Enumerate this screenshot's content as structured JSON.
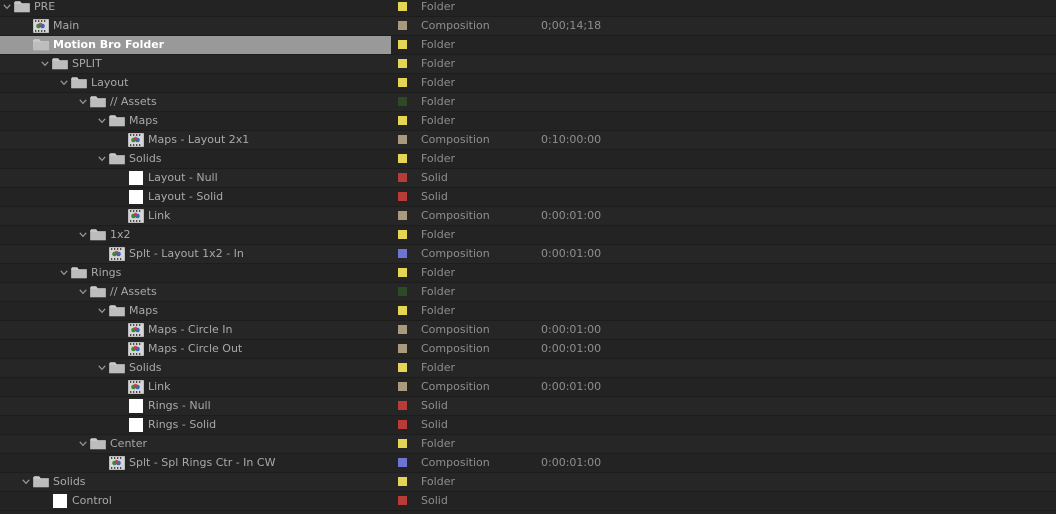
{
  "colors": {
    "yellow": "#e6d454",
    "tan": "#a89a7e",
    "green": "#2b4a25",
    "red": "#b73b36",
    "blue": "#6f74d3"
  },
  "items": [
    {
      "name": "PRE",
      "type": "Folder",
      "duration": "",
      "label_color": "yellow",
      "icon": "folder-icon",
      "depth": 0,
      "expanded": true,
      "selected": false
    },
    {
      "name": "Main",
      "type": "Composition",
      "duration": "0;00;14;18",
      "label_color": "tan",
      "icon": "composition-icon",
      "depth": 1,
      "expanded": null,
      "selected": false
    },
    {
      "name": "Motion Bro Folder",
      "type": "Folder",
      "duration": "",
      "label_color": "yellow",
      "icon": "folder-icon",
      "depth": 1,
      "expanded": true,
      "selected": true
    },
    {
      "name": "SPLIT",
      "type": "Folder",
      "duration": "",
      "label_color": "yellow",
      "icon": "folder-icon",
      "depth": 2,
      "expanded": true,
      "selected": false
    },
    {
      "name": "Layout",
      "type": "Folder",
      "duration": "",
      "label_color": "yellow",
      "icon": "folder-icon",
      "depth": 3,
      "expanded": true,
      "selected": false
    },
    {
      "name": "// Assets",
      "type": "Folder",
      "duration": "",
      "label_color": "green",
      "icon": "folder-icon",
      "depth": 4,
      "expanded": true,
      "selected": false
    },
    {
      "name": "Maps",
      "type": "Folder",
      "duration": "",
      "label_color": "yellow",
      "icon": "folder-icon",
      "depth": 5,
      "expanded": true,
      "selected": false
    },
    {
      "name": "Maps - Layout 2x1",
      "type": "Composition",
      "duration": "0:10:00:00",
      "label_color": "tan",
      "icon": "composition-icon",
      "depth": 6,
      "expanded": null,
      "selected": false
    },
    {
      "name": "Solids",
      "type": "Folder",
      "duration": "",
      "label_color": "yellow",
      "icon": "folder-icon",
      "depth": 5,
      "expanded": true,
      "selected": false
    },
    {
      "name": "Layout - Null",
      "type": "Solid",
      "duration": "",
      "label_color": "red",
      "icon": "solid-icon",
      "depth": 6,
      "expanded": null,
      "selected": false
    },
    {
      "name": "Layout - Solid",
      "type": "Solid",
      "duration": "",
      "label_color": "red",
      "icon": "solid-icon",
      "depth": 6,
      "expanded": null,
      "selected": false
    },
    {
      "name": "Link",
      "type": "Composition",
      "duration": "0:00:01:00",
      "label_color": "tan",
      "icon": "composition-icon",
      "depth": 6,
      "expanded": null,
      "selected": false
    },
    {
      "name": "1x2",
      "type": "Folder",
      "duration": "",
      "label_color": "yellow",
      "icon": "folder-icon",
      "depth": 4,
      "expanded": true,
      "selected": false
    },
    {
      "name": "Splt - Layout 1x2 - In",
      "type": "Composition",
      "duration": "0:00:01:00",
      "label_color": "blue",
      "icon": "composition-icon",
      "depth": 5,
      "expanded": null,
      "selected": false
    },
    {
      "name": "Rings",
      "type": "Folder",
      "duration": "",
      "label_color": "yellow",
      "icon": "folder-icon",
      "depth": 3,
      "expanded": true,
      "selected": false
    },
    {
      "name": "// Assets",
      "type": "Folder",
      "duration": "",
      "label_color": "green",
      "icon": "folder-icon",
      "depth": 4,
      "expanded": true,
      "selected": false
    },
    {
      "name": "Maps",
      "type": "Folder",
      "duration": "",
      "label_color": "yellow",
      "icon": "folder-icon",
      "depth": 5,
      "expanded": true,
      "selected": false
    },
    {
      "name": "Maps - Circle In",
      "type": "Composition",
      "duration": "0:00:01:00",
      "label_color": "tan",
      "icon": "composition-icon",
      "depth": 6,
      "expanded": null,
      "selected": false
    },
    {
      "name": "Maps - Circle Out",
      "type": "Composition",
      "duration": "0:00:01:00",
      "label_color": "tan",
      "icon": "composition-icon",
      "depth": 6,
      "expanded": null,
      "selected": false
    },
    {
      "name": "Solids",
      "type": "Folder",
      "duration": "",
      "label_color": "yellow",
      "icon": "folder-icon",
      "depth": 5,
      "expanded": true,
      "selected": false
    },
    {
      "name": "Link",
      "type": "Composition",
      "duration": "0:00:01:00",
      "label_color": "tan",
      "icon": "composition-icon",
      "depth": 6,
      "expanded": null,
      "selected": false
    },
    {
      "name": "Rings - Null",
      "type": "Solid",
      "duration": "",
      "label_color": "red",
      "icon": "solid-icon",
      "depth": 6,
      "expanded": null,
      "selected": false
    },
    {
      "name": "Rings - Solid",
      "type": "Solid",
      "duration": "",
      "label_color": "red",
      "icon": "solid-icon",
      "depth": 6,
      "expanded": null,
      "selected": false
    },
    {
      "name": "Center",
      "type": "Folder",
      "duration": "",
      "label_color": "yellow",
      "icon": "folder-icon",
      "depth": 4,
      "expanded": true,
      "selected": false
    },
    {
      "name": "Splt - Spl Rings Ctr - In CW",
      "type": "Composition",
      "duration": "0:00:01:00",
      "label_color": "blue",
      "icon": "composition-icon",
      "depth": 5,
      "expanded": null,
      "selected": false
    },
    {
      "name": "Solids",
      "type": "Folder",
      "duration": "",
      "label_color": "yellow",
      "icon": "folder-icon",
      "depth": 1,
      "expanded": true,
      "selected": false
    },
    {
      "name": "Control",
      "type": "Solid",
      "duration": "",
      "label_color": "red",
      "icon": "solid-icon",
      "depth": 2,
      "expanded": null,
      "selected": false
    }
  ]
}
